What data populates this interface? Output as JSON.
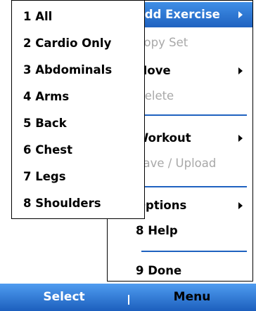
{
  "main_menu": {
    "items": [
      {
        "label": "Add Exercise",
        "enabled": true,
        "selected": true,
        "submenu": true
      },
      {
        "label": "Copy Set",
        "enabled": false,
        "selected": false,
        "submenu": false
      },
      {
        "label": "Move",
        "enabled": true,
        "selected": false,
        "submenu": true
      },
      {
        "label": "Delete",
        "enabled": false,
        "selected": false,
        "submenu": false
      },
      {
        "label": "Workout",
        "enabled": true,
        "selected": false,
        "submenu": true
      },
      {
        "label": "Save / Upload",
        "enabled": false,
        "selected": false,
        "submenu": false
      },
      {
        "label": "Options",
        "enabled": true,
        "selected": false,
        "submenu": true
      },
      {
        "label": "8 Help",
        "enabled": true,
        "selected": false,
        "submenu": false
      },
      {
        "label": "9 Done",
        "enabled": true,
        "selected": false,
        "submenu": false
      }
    ]
  },
  "submenu": {
    "items": [
      {
        "label": "1 All"
      },
      {
        "label": "2 Cardio Only"
      },
      {
        "label": "3 Abdominals"
      },
      {
        "label": "4 Arms"
      },
      {
        "label": "5 Back"
      },
      {
        "label": "6 Chest"
      },
      {
        "label": "7 Legs"
      },
      {
        "label": "8 Shoulders"
      }
    ]
  },
  "softkeys": {
    "left": "Select",
    "right": "Menu"
  },
  "colors": {
    "selection": "#2f78d8",
    "disabled_text": "#a8a8a8",
    "separator": "#1f62c0",
    "softkey_bar": "#2f78d8"
  }
}
